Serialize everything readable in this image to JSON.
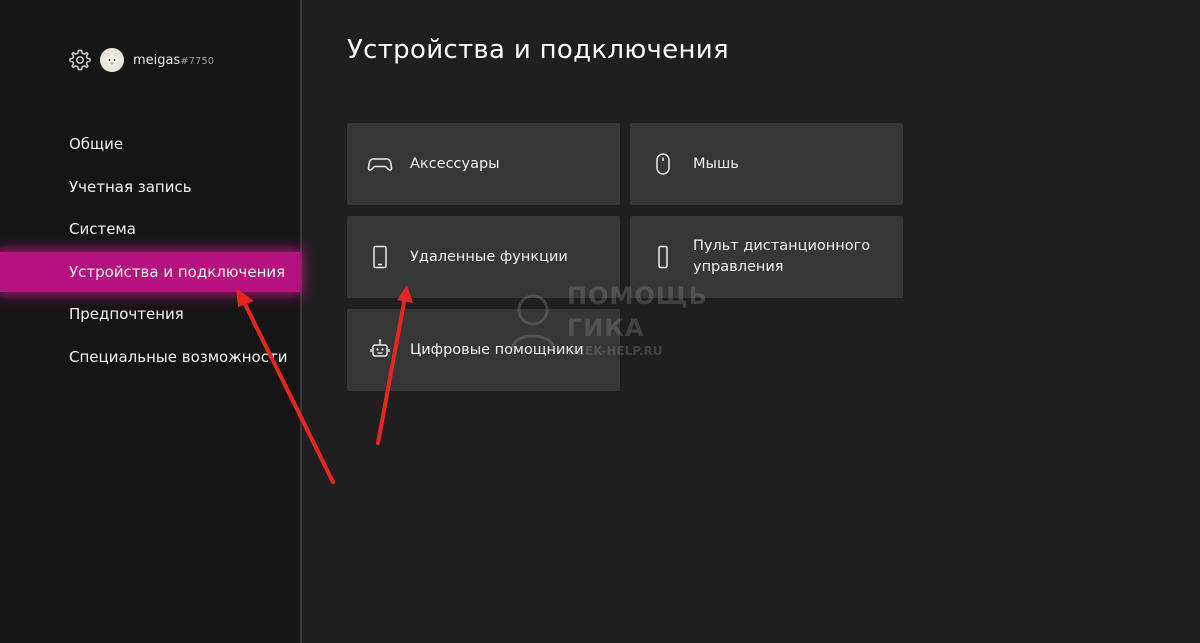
{
  "profile": {
    "gamertag": "meigas",
    "tag_suffix": "#7750"
  },
  "sidebar": {
    "items": [
      {
        "label": "Общие",
        "selected": false
      },
      {
        "label": "Учетная запись",
        "selected": false
      },
      {
        "label": "Система",
        "selected": false
      },
      {
        "label": "Устройства и подключения",
        "selected": true
      },
      {
        "label": "Предпочтения",
        "selected": false
      },
      {
        "label": "Специальные возможности",
        "selected": false
      }
    ]
  },
  "main": {
    "title": "Устройства и подключения",
    "tiles": [
      {
        "label": "Аксессуары",
        "icon": "gamepad-icon"
      },
      {
        "label": "Мышь",
        "icon": "mouse-icon"
      },
      {
        "label": "Удаленные функции",
        "icon": "phone-icon"
      },
      {
        "label": "Пульт дистанционного управления",
        "icon": "remote-icon"
      },
      {
        "label": "Цифровые помощники",
        "icon": "assistant-bot-icon"
      }
    ]
  },
  "watermark": {
    "line1": "ПОМОЩЬ",
    "line2": "ГИКА",
    "line3": "GEEK-HELP.RU"
  },
  "colors": {
    "background": "#1f1f1f",
    "sidebar": "#151515",
    "tile": "#363636",
    "accent": "#b5127f",
    "annotation_arrow": "#e8261f"
  }
}
